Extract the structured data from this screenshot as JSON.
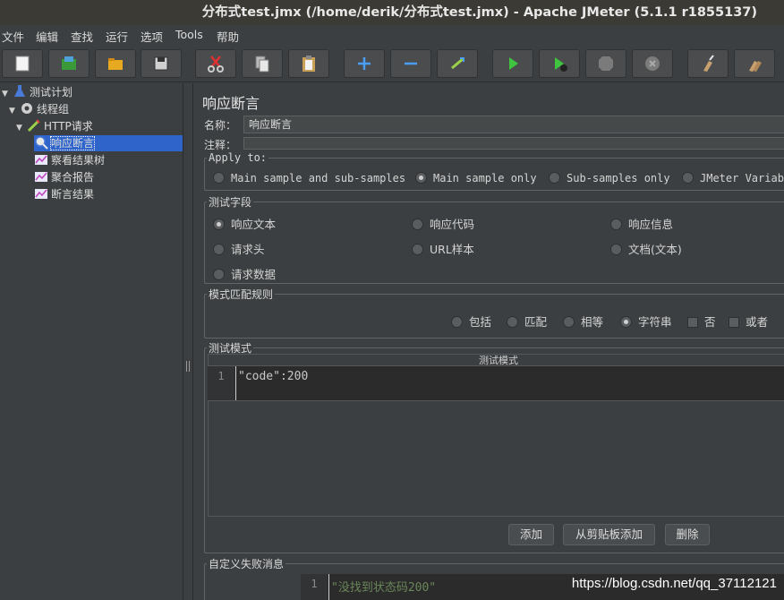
{
  "window": {
    "title": "分布式test.jmx (/home/derik/分布式test.jmx) - Apache JMeter (5.1.1 r1855137)"
  },
  "menu": [
    "文件",
    "编辑",
    "查找",
    "运行",
    "选项",
    "Tools",
    "帮助"
  ],
  "toolbar": [
    {
      "icon": "new-icon"
    },
    {
      "icon": "templates-icon"
    },
    {
      "icon": "open-icon"
    },
    {
      "icon": "save-icon"
    },
    {
      "icon": "cut-icon"
    },
    {
      "icon": "copy-icon"
    },
    {
      "icon": "paste-icon"
    },
    {
      "icon": "expand-icon"
    },
    {
      "icon": "collapse-icon"
    },
    {
      "icon": "toggle-icon"
    },
    {
      "icon": "start-icon"
    },
    {
      "icon": "start-no-pauses-icon"
    },
    {
      "icon": "stop-icon"
    },
    {
      "icon": "shutdown-icon"
    },
    {
      "icon": "clear-icon"
    },
    {
      "icon": "clear-all-icon"
    }
  ],
  "tree": [
    {
      "label": "测试计划",
      "arrow": "▼",
      "icon": "test-plan-icon"
    },
    {
      "label": "线程组",
      "arrow": "▼",
      "icon": "thread-group-icon"
    },
    {
      "label": "HTTP请求",
      "arrow": "▼",
      "icon": "http-sampler-icon"
    },
    {
      "label": "响应断言",
      "arrow": "",
      "icon": "assertion-icon",
      "selected": true
    },
    {
      "label": "察看结果树",
      "arrow": "",
      "icon": "listener-icon"
    },
    {
      "label": "聚合报告",
      "arrow": "",
      "icon": "listener-icon"
    },
    {
      "label": "断言结果",
      "arrow": "",
      "icon": "listener-icon"
    }
  ],
  "panel": {
    "heading": "响应断言",
    "name_label": "名称：",
    "name_value": "响应断言",
    "comment_label": "注释：",
    "apply_to": {
      "legend": "Apply to:",
      "options": [
        "Main sample and sub-samples",
        "Main sample only",
        "Sub-samples only",
        "JMeter Variabl"
      ],
      "selected": 1
    },
    "field_to_test": {
      "legend": "测试字段",
      "options": [
        "响应文本",
        "响应代码",
        "响应信息",
        "请求头",
        "URL样本",
        "文档(文本)",
        "请求数据"
      ],
      "selected": 0
    },
    "matching_rules": {
      "legend": "模式匹配规则",
      "radios": [
        "包括",
        "匹配",
        "相等",
        "字符串"
      ],
      "selected": 3,
      "checks": [
        "否",
        "或者"
      ]
    },
    "patterns": {
      "legend": "测试模式",
      "column_header": "测试模式",
      "line_number": "1",
      "code": "\"code\":200",
      "buttons": [
        "添加",
        "从剪贴板添加",
        "删除"
      ]
    },
    "custom_failure": {
      "legend": "自定义失败消息",
      "line_number": "1",
      "code": "\"没找到状态码200\""
    }
  },
  "watermark": "https://blog.csdn.net/qq_37112121",
  "colors": {
    "selection": "#2f65ca",
    "background": "#3c3f41",
    "editor": "#2b2b2b",
    "string": "#6a8759"
  }
}
